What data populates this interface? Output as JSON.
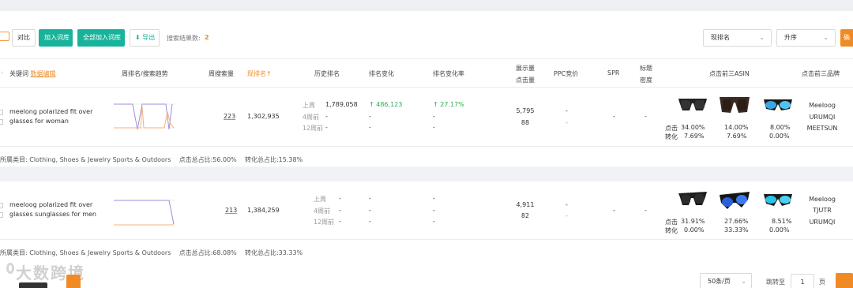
{
  "toolbar": {
    "compare": "对比",
    "add_to_lib": "加入词库",
    "add_all_to_lib": "全部加入词库",
    "export": "导出",
    "result_label": "搜索结果数:",
    "result_count": "2",
    "sort_field": "现排名",
    "sort_order": "升序",
    "confirm": "确"
  },
  "headers": {
    "keyword": "关键词",
    "data_edit": "数据编辑",
    "weekly_trend": "周排名/搜索趋势",
    "weekly_search": "周搜索量",
    "current_rank": "现排名",
    "current_rank_arrow": "↑",
    "history_rank": "历史排名",
    "rank_change": "排名变化",
    "rank_change_rate": "排名变化率",
    "impressions": "展示量",
    "clicks": "点击量",
    "ppc_bid": "PPC竞价",
    "spr": "SPR",
    "title": "标题",
    "density": "密度",
    "top3_asin": "点击前三ASIN",
    "top3_brand": "点击前三品牌"
  },
  "rows": [
    {
      "keyword": "meelong polarized fit over glasses for woman",
      "weekly_search": "223",
      "current_rank": "1,302,935",
      "history": [
        {
          "label": "上周",
          "rank": "1,789,058",
          "change": "486,123",
          "rate": "27.17%"
        },
        {
          "label": "4周前",
          "rank": "-",
          "change": "-",
          "rate": "-"
        },
        {
          "label": "12周前",
          "rank": "-",
          "change": "-",
          "rate": "-"
        }
      ],
      "impressions": "5,795",
      "clicks": "88",
      "ppc_1": "-",
      "ppc_2": "-",
      "spr": "-",
      "density": "-",
      "click_label": "点击",
      "conv_label": "转化",
      "asins": [
        {
          "click": "34.00%",
          "conv": "7.69%",
          "icon": "sunglasses-black-icon"
        },
        {
          "click": "14.00%",
          "conv": "7.69%",
          "icon": "sunglasses-brown-icon"
        },
        {
          "click": "8.00%",
          "conv": "0.00%",
          "icon": "sunglasses-blue-icon"
        }
      ],
      "brands": [
        "Meeloog",
        "URUMQI",
        "MEETSUN"
      ],
      "category": "所属类目: Clothing, Shoes & Jewelry Sports & Outdoors",
      "click_total": "点击总占比:56.00%",
      "conv_total": "转化总占比:15.38%"
    },
    {
      "keyword": "meeloog polarized fit over glasses sunglasses for men",
      "weekly_search": "213",
      "current_rank": "1,384,259",
      "history": [
        {
          "label": "上周",
          "rank": "-",
          "change": "-",
          "rate": "-"
        },
        {
          "label": "4周前",
          "rank": "-",
          "change": "-",
          "rate": "-"
        },
        {
          "label": "12周前",
          "rank": "-",
          "change": "-",
          "rate": "-"
        }
      ],
      "impressions": "4,911",
      "clicks": "82",
      "ppc_1": "-",
      "ppc_2": "-",
      "spr": "-",
      "density": "-",
      "click_label": "点击",
      "conv_label": "转化",
      "asins": [
        {
          "click": "31.91%",
          "conv": "0.00%",
          "icon": "sunglasses-black-icon"
        },
        {
          "click": "27.66%",
          "conv": "33.33%",
          "icon": "sunglasses-blue-mirror-icon"
        },
        {
          "click": "8.51%",
          "conv": "0.00%",
          "icon": "sunglasses-cyan-icon"
        }
      ],
      "brands": [
        "Meeloog",
        "TJUTR",
        "URUMQI"
      ],
      "category": "所属类目: Clothing, Shoes & Jewelry Sports & Outdoors",
      "click_total": "点击总占比:68.08%",
      "conv_total": "转化总占比:33.33%"
    }
  ],
  "pagination": {
    "page_size": "50条/页",
    "goto": "跳转至",
    "page_value": "1",
    "page_unit": "页"
  },
  "watermark": "大数跨境",
  "colors": {
    "accent_orange": "#f08a24",
    "accent_green": "#18b39a",
    "positive_green": "#2eaa55",
    "trend_purple": "#9b8fe0",
    "trend_orange": "#f5b07a"
  }
}
